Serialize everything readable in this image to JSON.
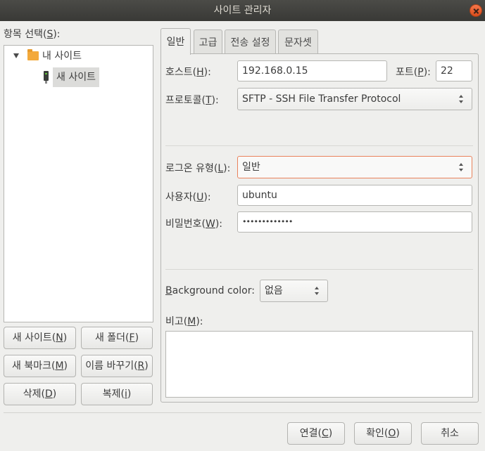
{
  "window": {
    "title": "사이트 관리자"
  },
  "left": {
    "select_label": "항목 선택(",
    "select_key": "S",
    "select_suffix": "):",
    "tree": [
      {
        "label": "내 사이트",
        "icon": "folder-icon"
      },
      {
        "label": "새 사이트",
        "icon": "server-icon",
        "selected": true
      }
    ],
    "buttons": {
      "new_site": {
        "pre": "새 사이트(",
        "key": "N",
        "post": ")"
      },
      "new_folder": {
        "pre": "새 폴더(",
        "key": "F",
        "post": ")"
      },
      "new_bookmark": {
        "pre": "새 북마크(",
        "key": "M",
        "post": ")"
      },
      "rename": {
        "pre": "이름 바꾸기(",
        "key": "R",
        "post": ")"
      },
      "delete": {
        "pre": "삭제(",
        "key": "D",
        "post": ")"
      },
      "duplicate": {
        "pre": "복제(",
        "key": "i",
        "post": ")"
      }
    }
  },
  "tabs": [
    {
      "label": "일반",
      "active": true
    },
    {
      "label": "고급"
    },
    {
      "label": "전송 설정"
    },
    {
      "label": "문자셋"
    }
  ],
  "general": {
    "host": {
      "pre": "호스트(",
      "key": "H",
      "post": "):",
      "value": "192.168.0.15"
    },
    "port": {
      "pre": "포트(",
      "key": "P",
      "post": "):",
      "value": "22"
    },
    "protocol": {
      "pre": "프로토콜(",
      "key": "T",
      "post": "):",
      "value": "SFTP - SSH File Transfer Protocol"
    },
    "logon_type": {
      "pre": "로그온 유형(",
      "key": "L",
      "post": "):",
      "value": "일반"
    },
    "user": {
      "pre": "사용자(",
      "key": "U",
      "post": "):",
      "value": "ubuntu"
    },
    "password": {
      "pre": "비밀번호(",
      "key": "W",
      "post": "):",
      "value": "•••••••••••••"
    },
    "background_color": {
      "key": "B",
      "rest": "ackground color:",
      "value": "없음"
    },
    "comments": {
      "pre": "비고(",
      "key": "M",
      "post": "):",
      "value": ""
    }
  },
  "footer": {
    "connect": {
      "pre": "연결(",
      "key": "C",
      "post": ")"
    },
    "ok": {
      "pre": "확인(",
      "key": "O",
      "post": ")"
    },
    "cancel": "취소"
  },
  "colors": {
    "titlebar": "#3c3b37",
    "focus_border": "#e9825c",
    "window_bg": "#efefed"
  }
}
